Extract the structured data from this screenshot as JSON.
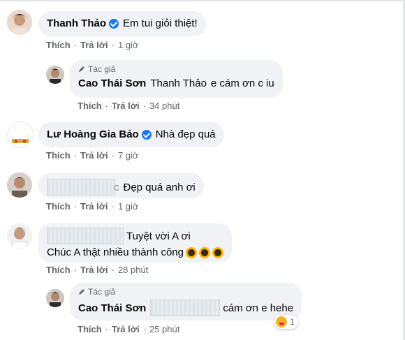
{
  "labels": {
    "like": "Thích",
    "reply": "Trả lời",
    "dot": "·",
    "author_tag": "Tác giả"
  },
  "comments": [
    {
      "name": "Thanh Thảo",
      "text": "Em tui giỏi thiệt!",
      "time": "1 giờ"
    },
    {
      "author_reply": true,
      "name": "Cao Thái Sơn",
      "mention": "Thanh Thảo",
      "text": "e cám ơn c iu",
      "time": "34 phút"
    },
    {
      "name": "Lư Hoàng Gia Bảo",
      "text": "Nhà đẹp quá",
      "time": "7 giờ"
    },
    {
      "name_fragment": "c",
      "text": "Đẹp quá anh ơi",
      "time": "1 giờ"
    },
    {
      "line1": "Tuyệt vời A ơi",
      "line2": "Chúc A thật nhiều thành công",
      "time": "28 phút"
    },
    {
      "author_reply": true,
      "name": "Cao Thái Sơn",
      "text": "cám ơn e hehe",
      "time": "25 phút",
      "reaction_count": "1"
    }
  ],
  "colors": {
    "verified": "#1877f2",
    "bubble": "#f0f2f5",
    "meta": "#65676b"
  },
  "icons": [
    "verified-badge-icon",
    "pencil-icon",
    "sunflower-emoji-icon",
    "haha-reaction-icon"
  ]
}
